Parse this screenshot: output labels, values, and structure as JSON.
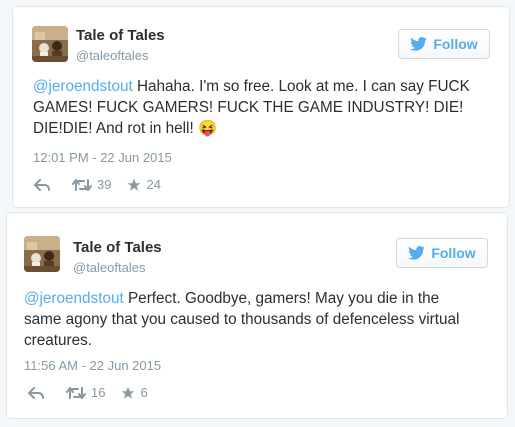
{
  "tweets": [
    {
      "name": "Tale of Tales",
      "handle": "@taleoftales",
      "follow_label": "Follow",
      "mention": "@jeroendstout",
      "lines": [
        " Hahaha. I'm so free. Look at me. I can say FUCK",
        "GAMES! FUCK GAMERS! FUCK THE GAME INDUSTRY! DIE!",
        "DIE!DIE! And rot in hell! "
      ],
      "emoji": "😝",
      "timestamp": "12:01 PM - 22 Jun 2015",
      "retweets": "39",
      "favorites": "24"
    },
    {
      "name": "Tale of Tales",
      "handle": "@taleoftales",
      "follow_label": "Follow",
      "mention": "@jeroendstout",
      "lines": [
        " Perfect. Goodbye, gamers! May you die in the",
        "same agony that you caused to thousands of defenceless virtual",
        "creatures."
      ],
      "emoji": "",
      "timestamp": "11:56 AM - 22 Jun 2015",
      "retweets": "16",
      "favorites": "6"
    }
  ],
  "colors": {
    "brand_blue": "#55acee",
    "muted_gray": "#8899a6",
    "text": "#292f33"
  },
  "icons": [
    "twitter-bird-icon",
    "reply-icon",
    "retweet-icon",
    "favorite-star-icon"
  ]
}
